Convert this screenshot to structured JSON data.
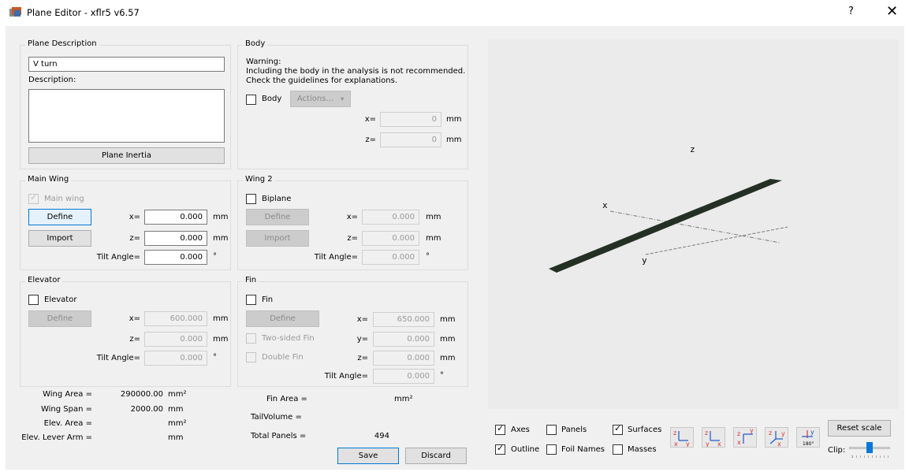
{
  "window": {
    "title": "Plane Editor - xflr5 v6.57",
    "help": "?",
    "close": "✕"
  },
  "plane_description": {
    "group_title": "Plane Description",
    "name_value": "V turn",
    "description_label": "Description:",
    "description_value": "",
    "inertia_button": "Plane Inertia"
  },
  "body": {
    "group_title": "Body",
    "warning_line1": "Warning:",
    "warning_line2": "Including the body in the analysis is not recommended.",
    "warning_line3": "Check the guidelines for explanations.",
    "body_checkbox": "Body",
    "body_checked": false,
    "actions_button": "Actions...",
    "x_label": "x=",
    "x_value": "0",
    "x_unit": "mm",
    "z_label": "z=",
    "z_value": "0",
    "z_unit": "mm"
  },
  "main_wing": {
    "group_title": "Main Wing",
    "checkbox": "Main wing",
    "checked": true,
    "define_button": "Define",
    "import_button": "Import",
    "x_label": "x=",
    "x_value": "0.000",
    "x_unit": "mm",
    "z_label": "z=",
    "z_value": "0.000",
    "z_unit": "mm",
    "tilt_label": "Tilt Angle=",
    "tilt_value": "0.000",
    "tilt_unit": "°"
  },
  "wing2": {
    "group_title": "Wing 2",
    "checkbox": "Biplane",
    "checked": false,
    "define_button": "Define",
    "import_button": "Import",
    "x_label": "x=",
    "x_value": "0.000",
    "x_unit": "mm",
    "z_label": "z=",
    "z_value": "0.000",
    "z_unit": "mm",
    "tilt_label": "Tilt Angle=",
    "tilt_value": "0.000",
    "tilt_unit": "°"
  },
  "elevator": {
    "group_title": "Elevator",
    "checkbox": "Elevator",
    "checked": false,
    "define_button": "Define",
    "x_label": "x=",
    "x_value": "600.000",
    "x_unit": "mm",
    "z_label": "z=",
    "z_value": "0.000",
    "z_unit": "mm",
    "tilt_label": "Tilt Angle=",
    "tilt_value": "0.000",
    "tilt_unit": "°"
  },
  "fin": {
    "group_title": "Fin",
    "checkbox": "Fin",
    "checked": false,
    "define_button": "Define",
    "two_sided": "Two-sided Fin",
    "double_fin": "Double Fin",
    "x_label": "x=",
    "x_value": "650.000",
    "x_unit": "mm",
    "y_label": "y=",
    "y_value": "0.000",
    "y_unit": "mm",
    "z_label": "z=",
    "z_value": "0.000",
    "z_unit": "mm",
    "tilt_label": "Tilt Angle=",
    "tilt_value": "0.000",
    "tilt_unit": "°"
  },
  "summary": {
    "wing_area_label": "Wing Area =",
    "wing_area_value": "290000.00",
    "wing_area_unit": "mm²",
    "wing_span_label": "Wing Span =",
    "wing_span_value": "2000.00",
    "wing_span_unit": "mm",
    "elev_area_label": "Elev. Area =",
    "elev_area_value": "",
    "elev_area_unit": "mm²",
    "elev_lever_label": "Elev. Lever Arm =",
    "elev_lever_value": "",
    "elev_lever_unit": "mm",
    "fin_area_label": "Fin Area =",
    "fin_area_value": "",
    "fin_area_unit": "mm²",
    "tail_volume_label": "TailVolume =",
    "tail_volume_value": "",
    "total_panels_label": "Total Panels =",
    "total_panels_value": "494"
  },
  "buttons": {
    "save": "Save",
    "discard": "Discard"
  },
  "view3d": {
    "axis_x": "x",
    "axis_y": "y",
    "axis_z": "z",
    "wing_color": "#253025",
    "checkboxes": [
      {
        "label": "Axes",
        "checked": true
      },
      {
        "label": "Panels",
        "checked": false
      },
      {
        "label": "Surfaces",
        "checked": true
      },
      {
        "label": "Outline",
        "checked": true
      },
      {
        "label": "Foil Names",
        "checked": false
      },
      {
        "label": "Masses",
        "checked": false
      }
    ],
    "view_icons": [
      "iso-view-xy-icon",
      "front-view-yx-icon",
      "side-view-xz-icon",
      "top-view-icon",
      "rotate-180-icon"
    ],
    "rotate_label": "180°",
    "reset_scale": "Reset scale",
    "clip_label": "Clip:",
    "clip_level": 0.5
  },
  "colors": {
    "axis_blue": "#1a56c8",
    "axis_red": "#e03030",
    "dialog_bg": "#f0f0f0"
  }
}
